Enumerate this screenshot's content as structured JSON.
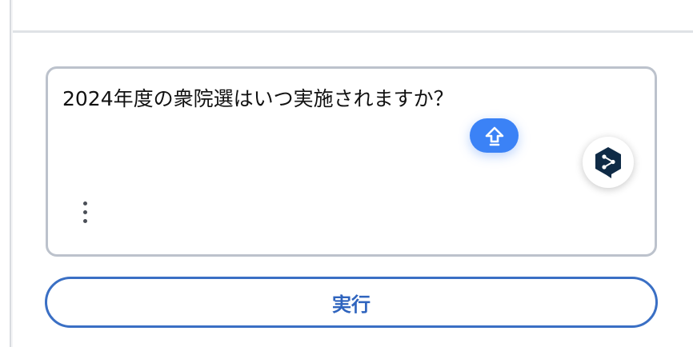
{
  "prompt": {
    "text": "2024年度の衆院選はいつ実施されますか？"
  },
  "actions": {
    "run_label": "実行"
  },
  "icons": {
    "upload": "upload-arrow-icon",
    "translator": "deepl-logo-icon",
    "menu": "more-vertical-icon"
  },
  "colors": {
    "accent": "#3b82f6",
    "button_border": "#3a6fc4",
    "textarea_border": "#bcc2cc",
    "deepl_logo": "#0f2b46"
  }
}
